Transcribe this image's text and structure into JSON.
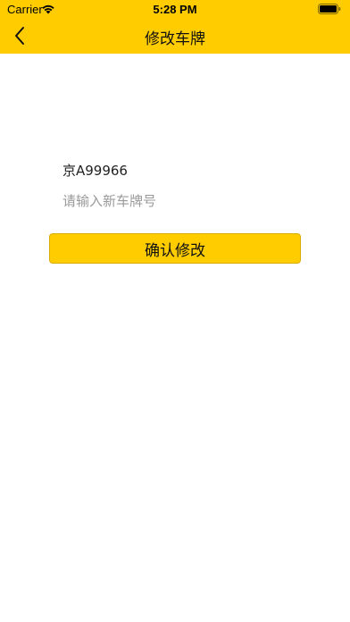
{
  "status_bar": {
    "carrier": "Carrier",
    "time": "5:28 PM"
  },
  "nav": {
    "title": "修改车牌",
    "back_icon": "chevron-left-icon"
  },
  "form": {
    "current_plate": "京A99966",
    "new_plate_value": "",
    "new_plate_placeholder": "请输入新车牌号",
    "confirm_label": "确认修改"
  },
  "colors": {
    "accent": "#FFCC00",
    "background": "#FFFFFF"
  }
}
